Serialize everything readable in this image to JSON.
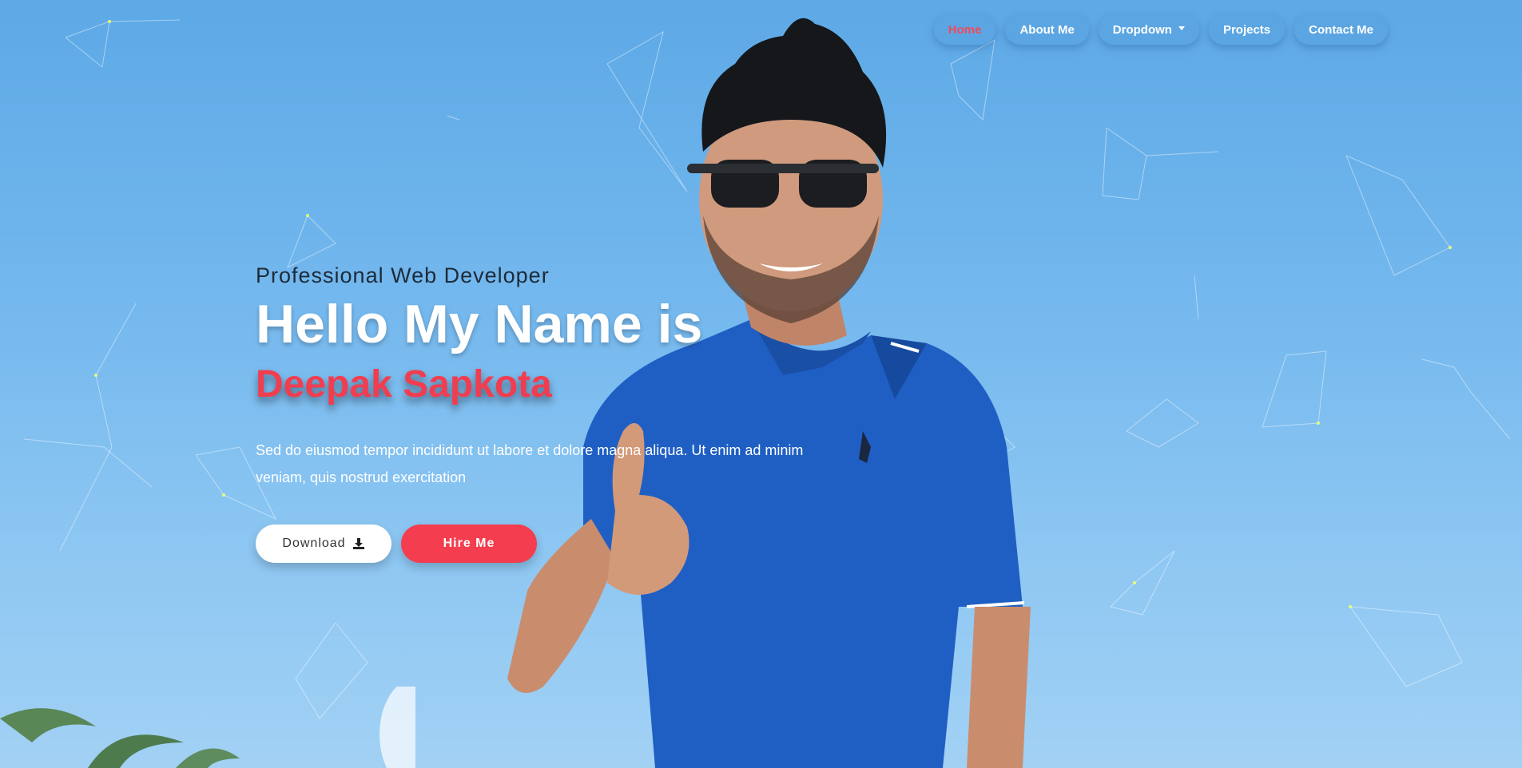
{
  "nav": {
    "items": [
      {
        "label": "Home",
        "active": true
      },
      {
        "label": "About Me",
        "active": false
      },
      {
        "label": "Dropdown",
        "active": false,
        "has_caret": true
      },
      {
        "label": "Projects",
        "active": false
      },
      {
        "label": "Contact Me",
        "active": false
      }
    ]
  },
  "hero": {
    "subtitle": "Professional Web Developer",
    "headline": "Hello My Name is",
    "name": "Deepak Sapkota",
    "description": "Sed do eiusmod tempor incididunt ut labore et dolore magna aliqua. Ut enim ad minim veniam, quis nostrud exercitation",
    "download_label": "Download",
    "download_icon": "download-icon",
    "hire_label": "Hire Me"
  },
  "colors": {
    "accent": "#f43d4f",
    "sky": "#74b8ee",
    "shirt": "#1f5fc4"
  }
}
